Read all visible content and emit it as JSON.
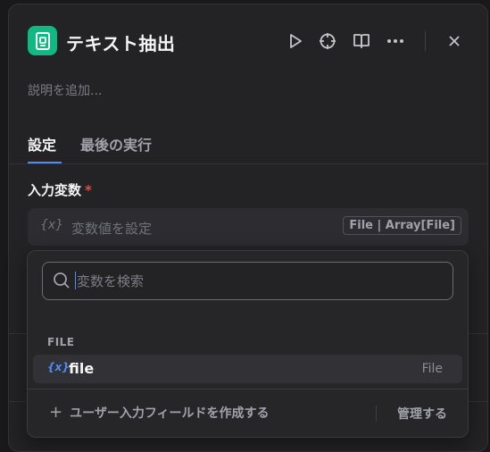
{
  "header": {
    "title": "テキスト抽出",
    "description_placeholder": "説明を追加...",
    "icons": [
      "run-icon",
      "crosshair-icon",
      "book-icon",
      "more-icon",
      "close-icon"
    ]
  },
  "tabs": [
    {
      "label": "設定",
      "active": true
    },
    {
      "label": "最後の実行",
      "active": false
    }
  ],
  "input_section": {
    "label": "入力変数",
    "required_mark": "*",
    "variable_icon": "{x}",
    "placeholder": "変数値を設定",
    "type_badge": "File | Array[File]"
  },
  "dropdown": {
    "search_placeholder": "変数を検索",
    "group_label": "FILE",
    "items": [
      {
        "icon": "{x}",
        "name": "file",
        "type": "File"
      }
    ],
    "create_label": "ユーザー入力フィールドを作成する",
    "manage_label": "管理する"
  },
  "colors": {
    "accent": "#4f8cf7",
    "app_icon_bg": "#10b981",
    "required": "#ef4444",
    "panel_bg": "#232326"
  }
}
